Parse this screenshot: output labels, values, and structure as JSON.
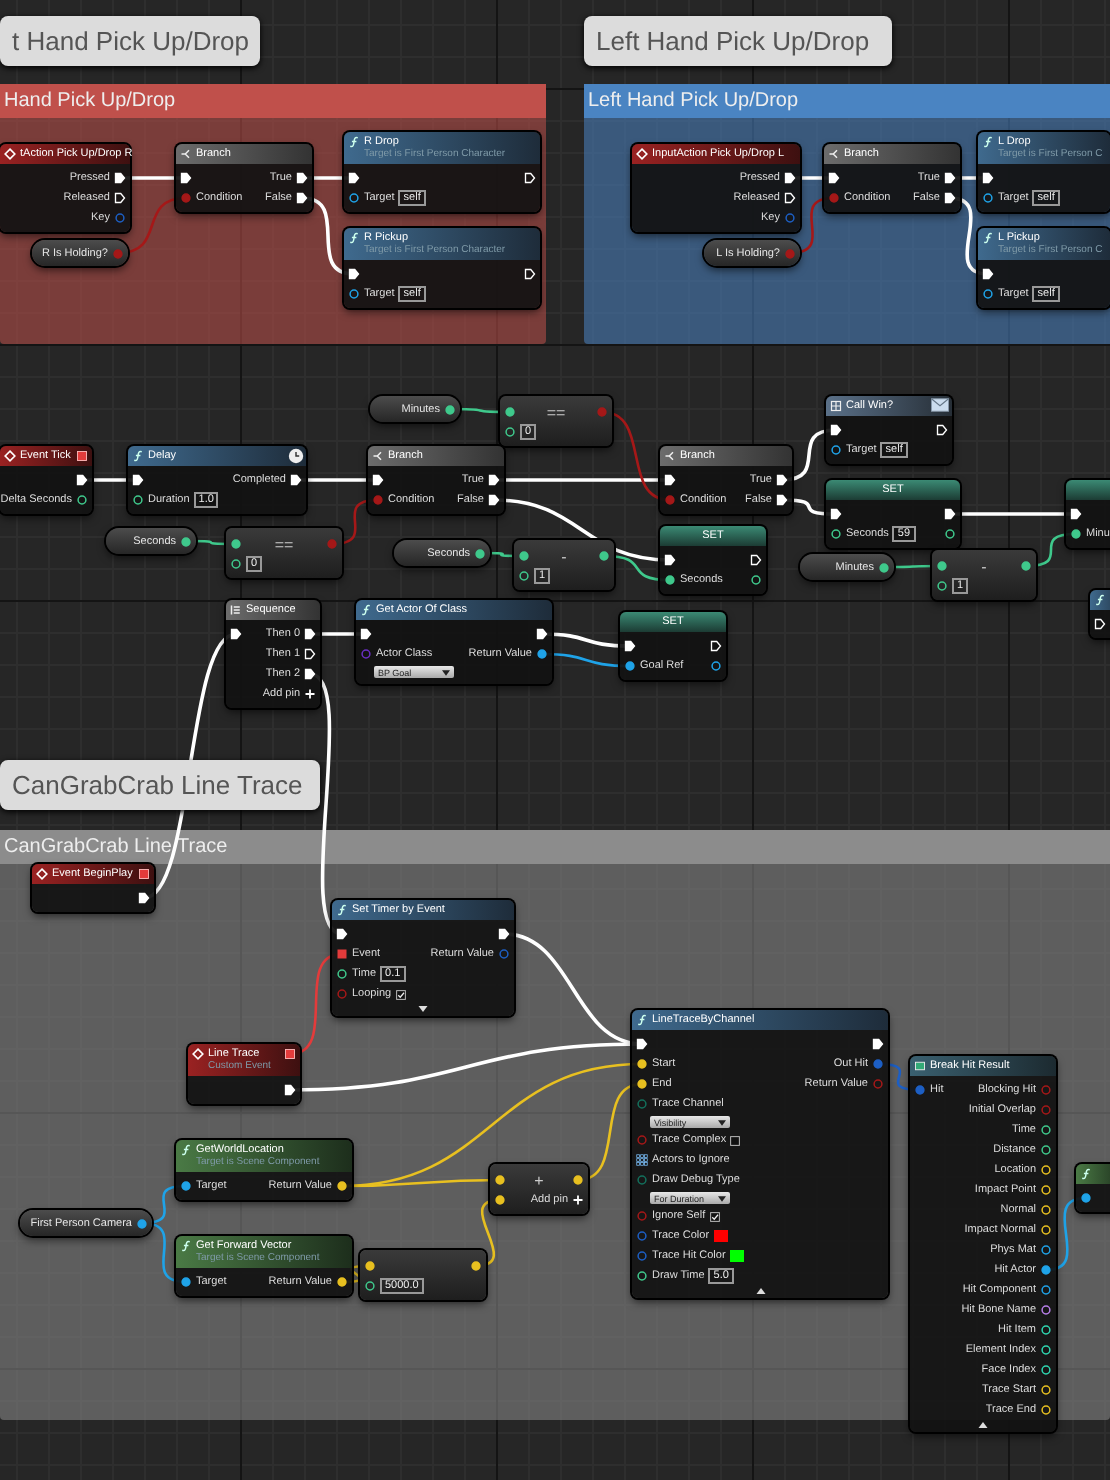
{
  "comment_bubbles": [
    {
      "text": "t Hand Pick Up/Drop"
    },
    {
      "text": "Left Hand Pick Up/Drop"
    },
    {
      "text": "CanGrabCrab Line Trace"
    }
  ],
  "comments": [
    {
      "title": "Hand Pick Up/Drop",
      "color": "#c0504b"
    },
    {
      "title": "Left Hand Pick Up/Drop",
      "color": "#4a84c2"
    },
    {
      "title": "CanGrabCrab Line Trace",
      "color": "#8c8c8c"
    }
  ],
  "nodes": [
    {
      "kind": "event",
      "title": "tAction Pick Up/Drop R",
      "delegate": false,
      "rows": [
        {
          "out": {
            "label": "Pressed",
            "kind": "exec",
            "linked": true
          }
        },
        {
          "out": {
            "label": "Released",
            "kind": "exec",
            "linked": false
          }
        },
        {
          "out": {
            "label": "Key",
            "kind": "struct",
            "linked": false
          }
        }
      ]
    },
    {
      "kind": "variable",
      "title": "R Is Holding?",
      "rows": [
        {
          "out": {
            "kind": "bool",
            "linked": true
          }
        }
      ]
    },
    {
      "kind": "branch",
      "title": "Branch",
      "rows": [
        {
          "in": {
            "kind": "exec",
            "linked": true
          },
          "out": {
            "label": "True",
            "kind": "exec",
            "linked": true
          }
        },
        {
          "in": {
            "label": "Condition",
            "kind": "bool",
            "linked": true
          },
          "out": {
            "label": "False",
            "kind": "exec",
            "linked": true
          }
        }
      ]
    },
    {
      "kind": "function",
      "title": "R Drop",
      "subtitle": "Target is First Person Character",
      "rows": [
        {
          "in": {
            "kind": "exec",
            "linked": true
          },
          "out": {
            "kind": "exec",
            "linked": false
          }
        },
        {
          "in": {
            "label": "Target",
            "kind": "object",
            "linked": false,
            "value": "self"
          }
        }
      ]
    },
    {
      "kind": "function",
      "title": "R Pickup",
      "subtitle": "Target is First Person Character",
      "rows": [
        {
          "in": {
            "kind": "exec",
            "linked": true
          },
          "out": {
            "kind": "exec",
            "linked": false
          }
        },
        {
          "in": {
            "label": "Target",
            "kind": "object",
            "linked": false,
            "value": "self"
          }
        }
      ]
    },
    {
      "kind": "event",
      "title": "InputAction Pick Up/Drop L",
      "delegate": false,
      "rows": [
        {
          "out": {
            "label": "Pressed",
            "kind": "exec",
            "linked": true
          }
        },
        {
          "out": {
            "label": "Released",
            "kind": "exec",
            "linked": false
          }
        },
        {
          "out": {
            "label": "Key",
            "kind": "struct",
            "linked": false
          }
        }
      ]
    },
    {
      "kind": "variable",
      "title": "L Is Holding?",
      "rows": [
        {
          "out": {
            "kind": "bool",
            "linked": true
          }
        }
      ]
    },
    {
      "kind": "branch",
      "title": "Branch",
      "rows": [
        {
          "in": {
            "kind": "exec",
            "linked": true
          },
          "out": {
            "label": "True",
            "kind": "exec",
            "linked": true
          }
        },
        {
          "in": {
            "label": "Condition",
            "kind": "bool",
            "linked": true
          },
          "out": {
            "label": "False",
            "kind": "exec",
            "linked": true
          }
        }
      ]
    },
    {
      "kind": "function",
      "title": "L Drop",
      "subtitle": "Target is First Person C",
      "rows": [
        {
          "in": {
            "kind": "exec",
            "linked": true
          }
        },
        {
          "in": {
            "label": "Target",
            "kind": "object",
            "linked": false,
            "value": "self"
          }
        }
      ]
    },
    {
      "kind": "function",
      "title": "L Pickup",
      "subtitle": "Target is First Person C",
      "rows": [
        {
          "in": {
            "kind": "exec",
            "linked": true
          }
        },
        {
          "in": {
            "label": "Target",
            "kind": "object",
            "linked": false,
            "value": "self"
          }
        }
      ]
    },
    {
      "kind": "variable",
      "title": "Minutes",
      "rows": [
        {
          "out": {
            "kind": "float",
            "linked": true
          }
        }
      ]
    },
    {
      "kind": "math",
      "title": "==",
      "rows": [
        {
          "in": {
            "kind": "float",
            "linked": true
          },
          "out": {
            "kind": "bool",
            "linked": true
          }
        },
        {
          "in": {
            "kind": "float",
            "linked": false,
            "value": "0"
          }
        }
      ]
    },
    {
      "kind": "message",
      "title": "Call Win?",
      "rows": [
        {
          "in": {
            "kind": "exec",
            "linked": true
          },
          "out": {
            "kind": "exec",
            "linked": false
          }
        },
        {
          "in": {
            "label": "Target",
            "kind": "object",
            "linked": false,
            "value": "self"
          }
        }
      ]
    },
    {
      "kind": "event",
      "title": "Event Tick",
      "delegate": true,
      "rows": [
        {
          "out": {
            "kind": "exec",
            "linked": true
          }
        },
        {
          "out": {
            "label": "Delta Seconds",
            "kind": "float",
            "linked": false
          }
        }
      ]
    },
    {
      "kind": "latent",
      "title": "Delay",
      "rows": [
        {
          "in": {
            "kind": "exec",
            "linked": true
          },
          "out": {
            "label": "Completed",
            "kind": "exec",
            "linked": true
          }
        },
        {
          "in": {
            "label": "Duration",
            "kind": "float",
            "linked": false,
            "value": "1.0"
          }
        }
      ]
    },
    {
      "kind": "branch",
      "title": "Branch",
      "rows": [
        {
          "in": {
            "kind": "exec",
            "linked": true
          },
          "out": {
            "label": "True",
            "kind": "exec",
            "linked": true
          }
        },
        {
          "in": {
            "label": "Condition",
            "kind": "bool",
            "linked": true
          },
          "out": {
            "label": "False",
            "kind": "exec",
            "linked": true
          }
        }
      ]
    },
    {
      "kind": "branch",
      "title": "Branch",
      "rows": [
        {
          "in": {
            "kind": "exec",
            "linked": true
          },
          "out": {
            "label": "True",
            "kind": "exec",
            "linked": true
          }
        },
        {
          "in": {
            "label": "Condition",
            "kind": "bool",
            "linked": true
          },
          "out": {
            "label": "False",
            "kind": "exec",
            "linked": true
          }
        }
      ]
    },
    {
      "kind": "set",
      "title": "SET",
      "rows": [
        {
          "in": {
            "kind": "exec",
            "linked": true
          },
          "out": {
            "kind": "exec",
            "linked": true
          }
        },
        {
          "in": {
            "label": "Seconds",
            "kind": "float",
            "linked": false,
            "value": "59"
          },
          "out": {
            "kind": "float",
            "linked": false
          }
        }
      ]
    },
    {
      "kind": "set",
      "rows": [
        {
          "in": {
            "kind": "exec",
            "linked": true
          }
        },
        {
          "in": {
            "label": "Minu",
            "kind": "float",
            "linked": true
          }
        }
      ]
    },
    {
      "kind": "variable",
      "title": "Seconds",
      "rows": [
        {
          "out": {
            "kind": "float",
            "linked": true
          }
        }
      ]
    },
    {
      "kind": "math",
      "title": "==",
      "rows": [
        {
          "in": {
            "kind": "float",
            "linked": true
          },
          "out": {
            "kind": "bool",
            "linked": true
          }
        },
        {
          "in": {
            "kind": "float",
            "linked": false,
            "value": "0"
          }
        }
      ]
    },
    {
      "kind": "variable",
      "title": "Seconds",
      "rows": [
        {
          "out": {
            "kind": "float",
            "linked": true
          }
        }
      ]
    },
    {
      "kind": "math",
      "title": "-",
      "rows": [
        {
          "in": {
            "kind": "float",
            "linked": true
          },
          "out": {
            "kind": "float",
            "linked": true
          }
        },
        {
          "in": {
            "kind": "float",
            "linked": false,
            "value": "1"
          }
        }
      ]
    },
    {
      "kind": "set",
      "title": "SET",
      "rows": [
        {
          "in": {
            "kind": "exec",
            "linked": true
          },
          "out": {
            "kind": "exec",
            "linked": false
          }
        },
        {
          "in": {
            "label": "Seconds",
            "kind": "float",
            "linked": true
          },
          "out": {
            "kind": "float",
            "linked": false
          }
        }
      ]
    },
    {
      "kind": "math",
      "title": "-",
      "rows": [
        {
          "in": {
            "kind": "float",
            "linked": true
          },
          "out": {
            "kind": "float",
            "linked": true
          }
        },
        {
          "in": {
            "kind": "float",
            "linked": false,
            "value": "1"
          }
        }
      ]
    },
    {
      "kind": "variable",
      "title": "Minutes",
      "rows": [
        {
          "out": {
            "kind": "float",
            "linked": true
          }
        }
      ]
    },
    {
      "kind": "function",
      "rows": [
        {
          "in": {
            "kind": "exec",
            "linked": false
          }
        }
      ]
    },
    {
      "kind": "sequence",
      "title": "Sequence",
      "rows": [
        {
          "in": {
            "kind": "exec",
            "linked": true
          },
          "out": {
            "label": "Then 0",
            "kind": "exec",
            "linked": true
          }
        },
        {
          "out": {
            "label": "Then 1",
            "kind": "exec",
            "linked": false
          }
        },
        {
          "out": {
            "label": "Then 2",
            "kind": "exec",
            "linked": true
          }
        },
        {
          "out": {
            "label": "Add pin",
            "kind": "add"
          }
        }
      ]
    },
    {
      "kind": "function",
      "title": "Get Actor Of Class",
      "rows": [
        {
          "in": {
            "kind": "exec",
            "linked": true
          },
          "out": {
            "kind": "exec",
            "linked": true
          }
        },
        {
          "in": {
            "label": "Actor Class",
            "kind": "class",
            "linked": false,
            "dropdown": "BP Goal"
          },
          "out": {
            "label": "Return Value",
            "kind": "object",
            "linked": true
          }
        }
      ]
    },
    {
      "kind": "set",
      "title": "SET",
      "rows": [
        {
          "in": {
            "kind": "exec",
            "linked": true
          },
          "out": {
            "kind": "exec",
            "linked": false
          }
        },
        {
          "in": {
            "label": "Goal Ref",
            "kind": "object",
            "linked": true
          },
          "out": {
            "kind": "object",
            "linked": false
          }
        }
      ]
    },
    {
      "kind": "event",
      "title": "Event BeginPlay",
      "delegate": true,
      "rows": [
        {
          "out": {
            "kind": "exec",
            "linked": true
          }
        }
      ]
    },
    {
      "kind": "function",
      "title": "Set Timer by Event",
      "expanded": false,
      "rows": [
        {
          "in": {
            "kind": "exec",
            "linked": true
          },
          "out": {
            "kind": "exec",
            "linked": true
          }
        },
        {
          "in": {
            "label": "Event",
            "kind": "delegate",
            "linked": true
          },
          "out": {
            "label": "Return Value",
            "kind": "struct",
            "linked": false
          }
        },
        {
          "in": {
            "label": "Time",
            "kind": "float",
            "linked": false,
            "value": "0.1"
          }
        },
        {
          "in": {
            "label": "Looping",
            "kind": "bool",
            "linked": false,
            "checked": true
          }
        }
      ]
    },
    {
      "kind": "function",
      "title": "LineTraceByChannel",
      "expanded": true,
      "rows": [
        {
          "in": {
            "kind": "exec",
            "linked": true
          },
          "out": {
            "kind": "exec",
            "linked": true
          }
        },
        {
          "in": {
            "label": "Start",
            "kind": "vector",
            "linked": true
          },
          "out": {
            "label": "Out Hit",
            "kind": "struct",
            "linked": true
          }
        },
        {
          "in": {
            "label": "End",
            "kind": "vector",
            "linked": true
          },
          "out": {
            "label": "Return Value",
            "kind": "bool",
            "linked": false
          }
        },
        {
          "in": {
            "label": "Trace Channel",
            "kind": "byte",
            "linked": false,
            "dropdown": "Visibility"
          }
        },
        {
          "in": {
            "label": "Trace Complex",
            "kind": "bool",
            "linked": false,
            "checked": false
          }
        },
        {
          "in": {
            "label": "Actors to Ignore",
            "kind": "array",
            "linked": false
          }
        },
        {
          "in": {
            "label": "Draw Debug Type",
            "kind": "byte",
            "linked": false,
            "dropdown": "For Duration"
          }
        },
        {
          "in": {
            "label": "Ignore Self",
            "kind": "bool",
            "linked": false,
            "checked": true
          }
        },
        {
          "in": {
            "label": "Trace Color",
            "kind": "struct",
            "linked": false,
            "color": "#ff0000"
          }
        },
        {
          "in": {
            "label": "Trace Hit Color",
            "kind": "struct",
            "linked": false,
            "color": "#00ff00"
          }
        },
        {
          "in": {
            "label": "Draw Time",
            "kind": "float",
            "linked": false,
            "value": "5.0"
          }
        }
      ]
    },
    {
      "kind": "event",
      "title": "Line Trace",
      "subtitle": "Custom Event",
      "delegate": true,
      "rows": [
        {
          "out": {
            "kind": "exec",
            "linked": true
          }
        }
      ]
    },
    {
      "kind": "break",
      "title": "Break Hit Result",
      "expanded": true,
      "rows": [
        {
          "in": {
            "label": "Hit",
            "kind": "struct",
            "linked": true
          },
          "out": {
            "label": "Blocking Hit",
            "kind": "bool",
            "linked": false
          }
        },
        {
          "out": {
            "label": "Initial Overlap",
            "kind": "bool",
            "linked": false
          }
        },
        {
          "out": {
            "label": "Time",
            "kind": "float",
            "linked": false
          }
        },
        {
          "out": {
            "label": "Distance",
            "kind": "float",
            "linked": false
          }
        },
        {
          "out": {
            "label": "Location",
            "kind": "vector",
            "linked": false
          }
        },
        {
          "out": {
            "label": "Impact Point",
            "kind": "vector",
            "linked": false
          }
        },
        {
          "out": {
            "label": "Normal",
            "kind": "vector",
            "linked": false
          }
        },
        {
          "out": {
            "label": "Impact Normal",
            "kind": "vector",
            "linked": false
          }
        },
        {
          "out": {
            "label": "Phys Mat",
            "kind": "object",
            "linked": false
          }
        },
        {
          "out": {
            "label": "Hit Actor",
            "kind": "object",
            "linked": true
          }
        },
        {
          "out": {
            "label": "Hit Component",
            "kind": "object",
            "linked": false
          }
        },
        {
          "out": {
            "label": "Hit Bone Name",
            "kind": "name",
            "linked": false
          }
        },
        {
          "out": {
            "label": "Hit Item",
            "kind": "int",
            "linked": false
          }
        },
        {
          "out": {
            "label": "Element Index",
            "kind": "int",
            "linked": false
          }
        },
        {
          "out": {
            "label": "Face Index",
            "kind": "int",
            "linked": false
          }
        },
        {
          "out": {
            "label": "Trace Start",
            "kind": "vector",
            "linked": false
          }
        },
        {
          "out": {
            "label": "Trace End",
            "kind": "vector",
            "linked": false
          }
        }
      ]
    },
    {
      "kind": "pure",
      "title": "GetWorldLocation",
      "subtitle": "Target is Scene Component",
      "rows": [
        {
          "in": {
            "label": "Target",
            "kind": "object",
            "linked": true
          },
          "out": {
            "label": "Return Value",
            "kind": "vector",
            "linked": true
          }
        }
      ]
    },
    {
      "kind": "math",
      "title": "+",
      "rows": [
        {
          "in": {
            "kind": "vector",
            "linked": true
          },
          "out": {
            "kind": "vector",
            "linked": true
          }
        },
        {
          "in": {
            "kind": "vector",
            "linked": true
          },
          "out": {
            "label": "Add pin",
            "kind": "add"
          }
        }
      ]
    },
    {
      "kind": "pure",
      "rows": [
        {
          "in": {
            "kind": "object",
            "linked": true
          }
        }
      ]
    },
    {
      "kind": "variable",
      "title": "First Person Camera",
      "rows": [
        {
          "out": {
            "kind": "object",
            "linked": true
          }
        }
      ]
    },
    {
      "kind": "pure",
      "title": "Get Forward Vector",
      "subtitle": "Target is Scene Component",
      "rows": [
        {
          "in": {
            "label": "Target",
            "kind": "object",
            "linked": true
          },
          "out": {
            "label": "Return Value",
            "kind": "vector",
            "linked": true
          }
        }
      ]
    },
    {
      "kind": "math",
      "rows": [
        {
          "in": {
            "kind": "vector",
            "linked": true
          },
          "out": {
            "kind": "vector",
            "linked": true
          }
        },
        {
          "in": {
            "kind": "float",
            "linked": false,
            "value": "5000.0"
          }
        }
      ]
    }
  ]
}
